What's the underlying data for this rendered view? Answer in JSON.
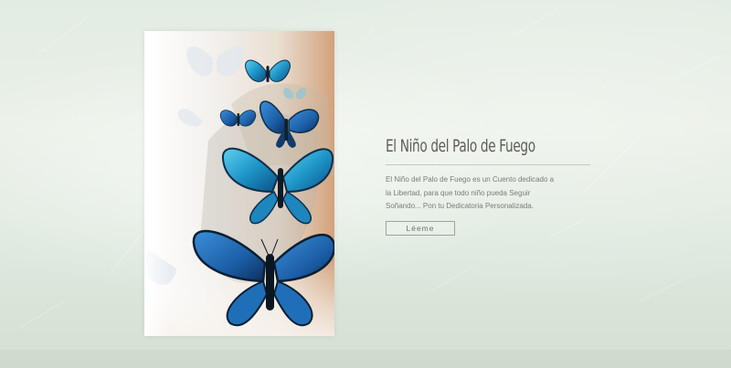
{
  "book": {
    "title": "El Niño del Palo de Fuego",
    "description": "El Niño del Palo de Fuego es un Cuento dedicado a la Libertad, para que todo niño pueda Seguir Soñando... Pon tu Dedicatoria Personalizada.",
    "read_label": "Léeme",
    "cover_icon": "butterflies-illustration"
  },
  "colors": {
    "background": "#e3ece4",
    "butterfly_blue": "#1e96c8",
    "butterfly_dark": "#0f2e4a",
    "title_text": "#5a5c58",
    "body_text": "#7a7c78"
  }
}
